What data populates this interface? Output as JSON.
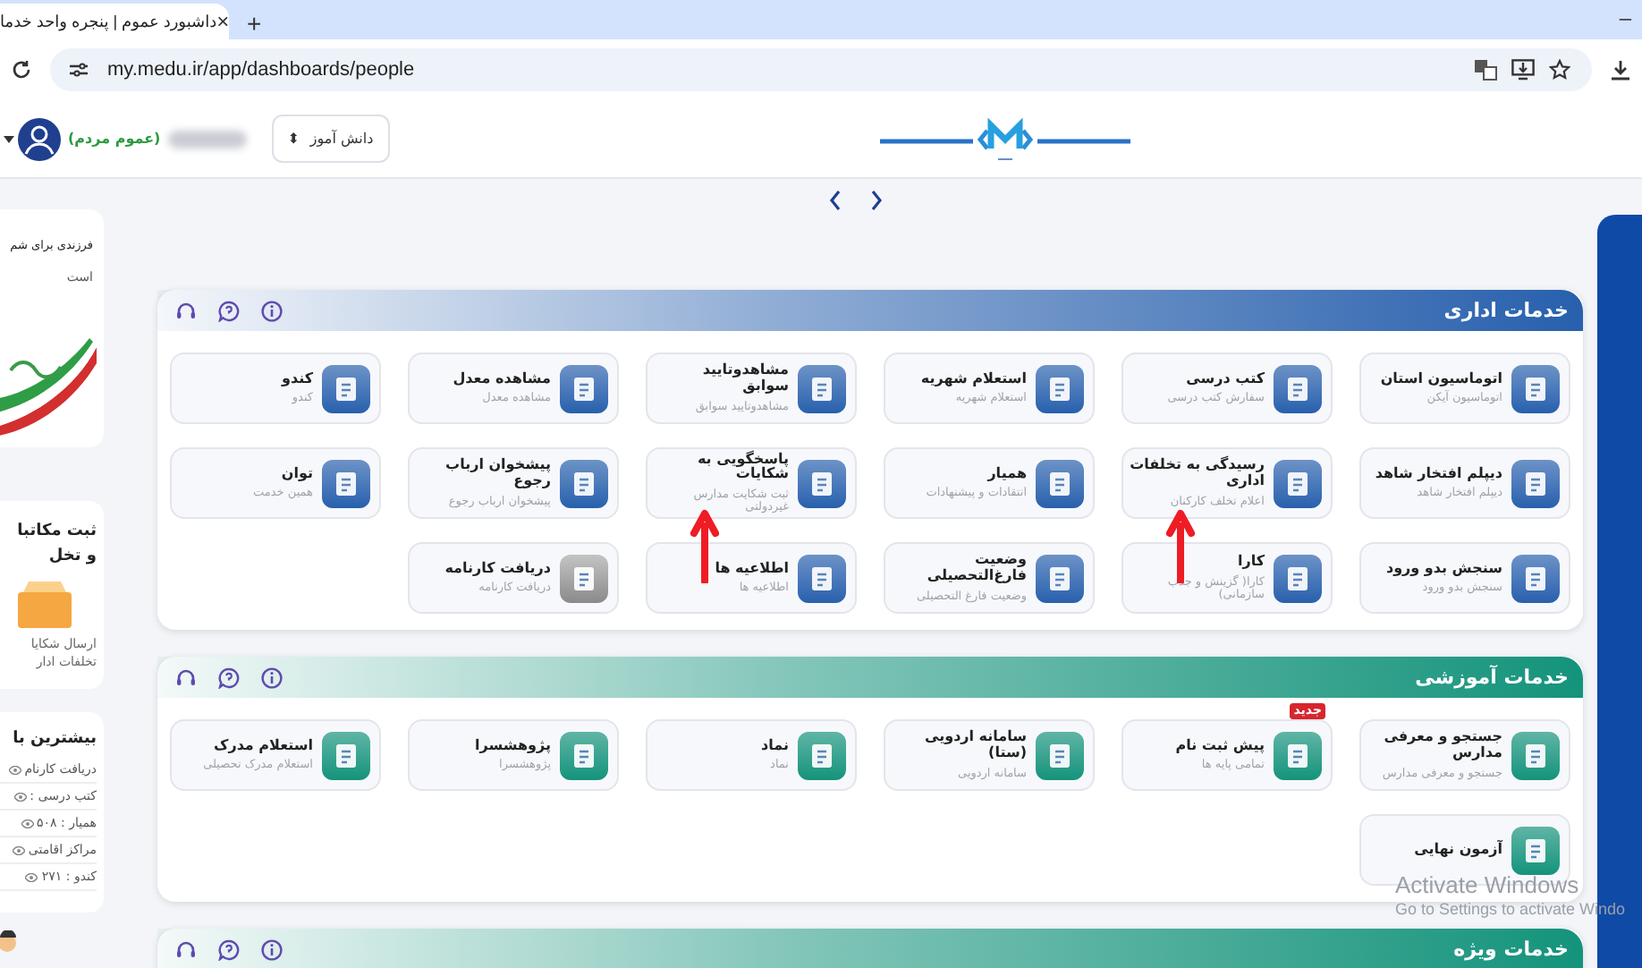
{
  "browser": {
    "tab": {
      "title": "داشبورد عموم | پنجره واحد خدما",
      "close": "×"
    },
    "new_tab": "+",
    "minimize": "–",
    "url": "my.medu.ir/app/dashboards/people"
  },
  "header": {
    "user_role": "(عموم مردم)",
    "role_select": {
      "value": "دانش آموز",
      "arrow": "⬍"
    }
  },
  "sidebar": {
    "banner": {
      "lines": [
        "فرزندی برای شم",
        "است"
      ]
    },
    "letters": {
      "lines": [
        "ثبت مکاتبا",
        "و تخل"
      ],
      "caption": [
        "ارسال شکایا",
        "تخلفات ادار"
      ]
    },
    "most_visited": {
      "title": "بیشترین با",
      "items": [
        "دریافت کارنام",
        "کتب درسی :",
        "همیار : ۵۰۸",
        "مراکز اقامتی",
        "کندو : ۲۷۱"
      ]
    }
  },
  "sections": [
    {
      "title": "خدمات اداری",
      "color": "#2860ad",
      "tiles": [
        {
          "title": "اتوماسیون استان",
          "subtitle": "اتوماسیون آیکن",
          "marked": false,
          "disabled": false
        },
        {
          "title": "کتب درسی",
          "subtitle": "سفارش کتب درسی",
          "marked": false,
          "disabled": false
        },
        {
          "title": "استعلام شهریه",
          "subtitle": "استعلام شهریه",
          "marked": false,
          "disabled": false
        },
        {
          "title": "مشاهدوتایید سوابق",
          "subtitle": "مشاهدوتایید سوابق",
          "marked": false,
          "disabled": false
        },
        {
          "title": "مشاهده معدل",
          "subtitle": "مشاهده معدل",
          "marked": false,
          "disabled": false
        },
        {
          "title": "کندو",
          "subtitle": "کندو",
          "marked": false,
          "disabled": false
        },
        {
          "title": "دیپلم افتخار شاهد",
          "subtitle": "دیپلم افتخار شاهد",
          "marked": false,
          "disabled": false
        },
        {
          "title": "رسیدگی به تخلفات اداری",
          "subtitle": "اعلام تخلف کارکنان",
          "marked": true,
          "disabled": false
        },
        {
          "title": "همیار",
          "subtitle": "انتقادات و پیشنهادات",
          "marked": false,
          "disabled": false
        },
        {
          "title": "پاسخگویی به شکایات",
          "subtitle": "ثبت شکایت مدارس غیردولتی",
          "marked": true,
          "disabled": false
        },
        {
          "title": "پیشخوان ارباب رجوع",
          "subtitle": "پیشخوان ارباب رجوع",
          "marked": false,
          "disabled": false
        },
        {
          "title": "توان",
          "subtitle": "همین خدمت",
          "marked": false,
          "disabled": false
        },
        {
          "title": "سنجش بدو ورود",
          "subtitle": "سنجش بدو ورود",
          "marked": false,
          "disabled": false
        },
        {
          "title": "کارا",
          "subtitle": "کارا( گزینش و جذب سازمانی)",
          "marked": false,
          "disabled": false
        },
        {
          "title": "وضعیت فارغ‌التحصیلی",
          "subtitle": "وضعیت فارغ التحصیلی",
          "marked": false,
          "disabled": false
        },
        {
          "title": "اطلاعیه ها",
          "subtitle": "اطلاعیه ها",
          "marked": false,
          "disabled": false
        },
        {
          "title": "دریافت کارنامه",
          "subtitle": "دریافت کارنامه",
          "marked": false,
          "disabled": true
        }
      ]
    },
    {
      "title": "خدمات آموزشی",
      "color": "#14937b",
      "tiles": [
        {
          "title": "جستجو و معرفی مدارس",
          "subtitle": "جستجو و معرفی مدارس",
          "marked": false,
          "disabled": false
        },
        {
          "title": "پیش ثبت نام",
          "subtitle": "تمامی پایه ها",
          "badge": "جدید",
          "marked": false,
          "disabled": false
        },
        {
          "title": "سامانه اردویی (ستا)",
          "subtitle": "سامانه اردویی",
          "marked": false,
          "disabled": false
        },
        {
          "title": "نماد",
          "subtitle": "نماد",
          "marked": false,
          "disabled": false
        },
        {
          "title": "پژوهشسرا",
          "subtitle": "پژوهشسرا",
          "marked": false,
          "disabled": false
        },
        {
          "title": "استعلام مدرک",
          "subtitle": "استعلام مدرک تحصیلی",
          "marked": false,
          "disabled": false
        },
        {
          "title": "آزمون نهایی",
          "marked": false,
          "disabled": false
        }
      ]
    },
    {
      "title": "خدمات ویژه",
      "color": "#14937b"
    }
  ],
  "os_notice": {
    "title": "Activate Windows",
    "text": "Go to Settings to activate Windo"
  }
}
